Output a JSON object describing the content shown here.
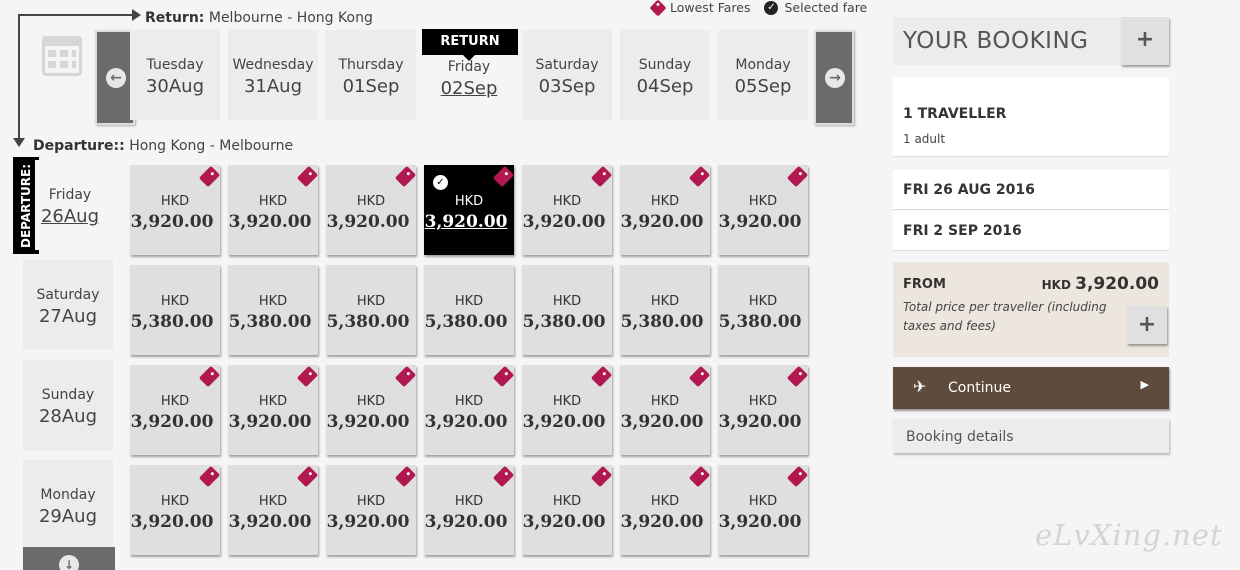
{
  "legend": {
    "lowest_fares": "Lowest Fares",
    "selected_fare": "Selected fare"
  },
  "return_route": {
    "label": "Return:",
    "value": "Melbourne - Hong Kong"
  },
  "departure_route": {
    "label": "Departure::",
    "value": "Hong Kong - Melbourne"
  },
  "return_badge": "RETURN",
  "departure_badge": "DEPARTURE:",
  "return_days": [
    {
      "day": "Tuesday",
      "date": "30Aug"
    },
    {
      "day": "Wednesday",
      "date": "31Aug"
    },
    {
      "day": "Thursday",
      "date": "01Sep"
    },
    {
      "day": "Friday",
      "date": "02Sep"
    },
    {
      "day": "Saturday",
      "date": "03Sep"
    },
    {
      "day": "Sunday",
      "date": "04Sep"
    },
    {
      "day": "Monday",
      "date": "05Sep"
    }
  ],
  "departure_days": [
    {
      "day": "Friday",
      "date": "26Aug"
    },
    {
      "day": "Saturday",
      "date": "27Aug"
    },
    {
      "day": "Sunday",
      "date": "28Aug"
    },
    {
      "day": "Monday",
      "date": "29Aug"
    }
  ],
  "fares": {
    "currency": "HKD",
    "rows": [
      [
        "3,920.00",
        "3,920.00",
        "3,920.00",
        "3,920.00",
        "3,920.00",
        "3,920.00",
        "3,920.00"
      ],
      [
        "5,380.00",
        "5,380.00",
        "5,380.00",
        "5,380.00",
        "5,380.00",
        "5,380.00",
        "5,380.00"
      ],
      [
        "3,920.00",
        "3,920.00",
        "3,920.00",
        "3,920.00",
        "3,920.00",
        "3,920.00",
        "3,920.00"
      ],
      [
        "3,920.00",
        "3,920.00",
        "3,920.00",
        "3,920.00",
        "3,920.00",
        "3,920.00",
        "3,920.00"
      ]
    ]
  },
  "booking": {
    "title": "YOUR BOOKING",
    "travellers": "1 TRAVELLER",
    "travellers_detail": "1 adult",
    "date1": "FRI 26 AUG 2016",
    "date2": "FRI 2 SEP 2016",
    "from_label": "FROM",
    "price_currency": "HKD",
    "price_value": "3,920.00",
    "price_note": "Total price per traveller (including taxes and fees)",
    "continue": "Continue",
    "details": "Booking details"
  },
  "watermark": "eLvXing.net",
  "colors": {
    "tag": "#b0184f",
    "continue_bg": "#5e4b3c",
    "selected_fare_bg": "#000000"
  }
}
